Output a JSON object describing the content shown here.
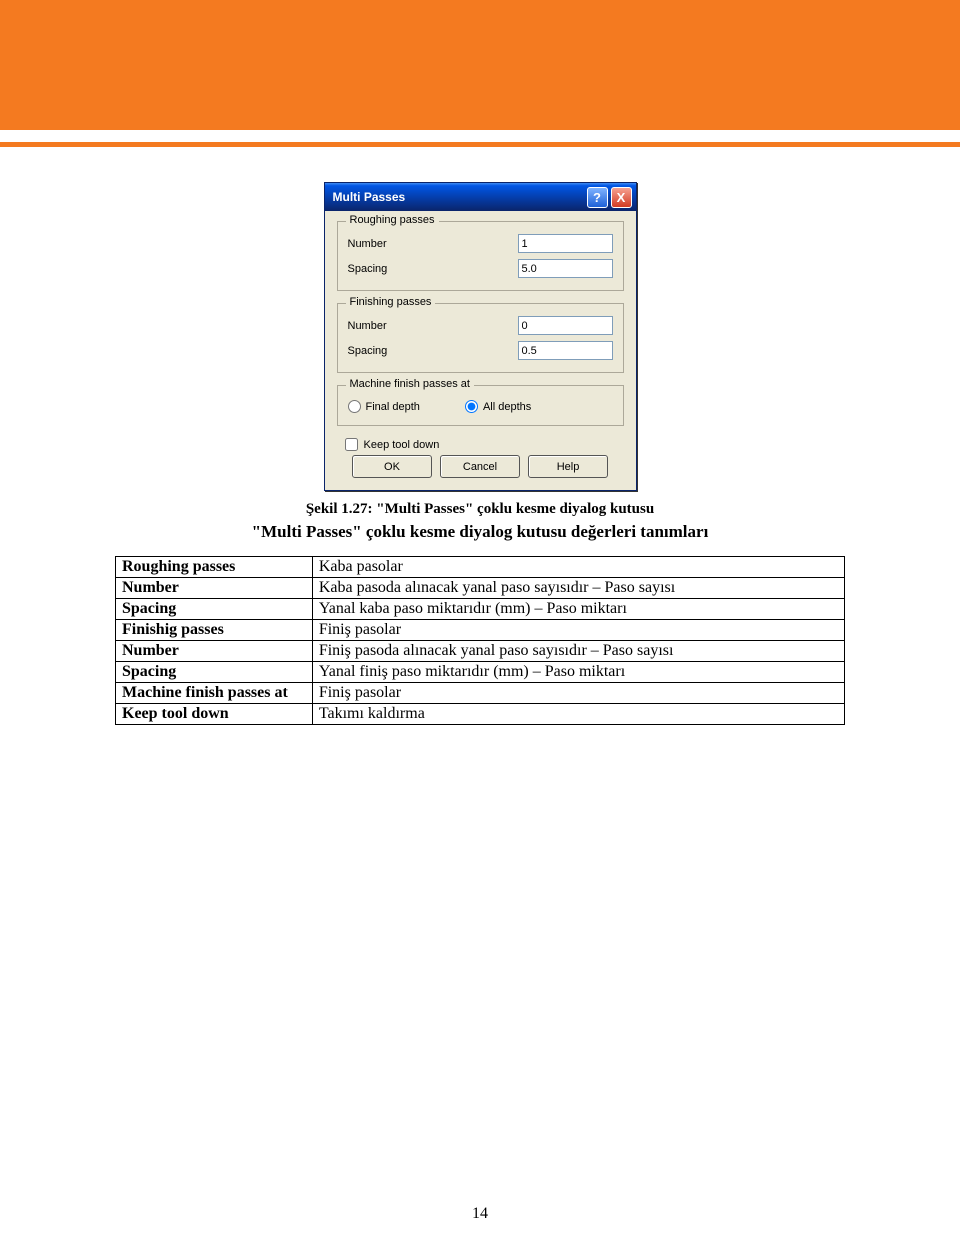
{
  "dialog": {
    "title": "Multi Passes",
    "help_glyph": "?",
    "close_glyph": "X",
    "roughing": {
      "legend": "Roughing passes",
      "number_label": "Number",
      "number_value": "1",
      "spacing_label": "Spacing",
      "spacing_value": "5.0"
    },
    "finishing": {
      "legend": "Finishing passes",
      "number_label": "Number",
      "number_value": "0",
      "spacing_label": "Spacing",
      "spacing_value": "0.5"
    },
    "machine_at": {
      "legend": "Machine finish passes at",
      "final_depth": "Final depth",
      "all_depths": "All depths"
    },
    "keep_tool_down": "Keep tool down",
    "buttons": {
      "ok": "OK",
      "cancel": "Cancel",
      "help": "Help"
    }
  },
  "caption": "Şekil 1.27: \"Multi Passes\" çoklu kesme diyalog kutusu",
  "subtitle": "\"Multi Passes\" çoklu kesme diyalog kutusu değerleri tanımları",
  "table": [
    {
      "term": "Roughing passes",
      "def": "Kaba pasolar"
    },
    {
      "term": "Number",
      "def": "Kaba pasoda alınacak yanal paso sayısıdır – Paso sayısı"
    },
    {
      "term": "Spacing",
      "def": "Yanal kaba paso miktarıdır (mm) – Paso miktarı"
    },
    {
      "term": "Finishig passes",
      "def": "Finiş pasolar"
    },
    {
      "term": "Number",
      "def": "Finiş pasoda alınacak yanal paso sayısıdır – Paso sayısı"
    },
    {
      "term": "Spacing",
      "def": "Yanal finiş paso miktarıdır (mm) – Paso miktarı"
    },
    {
      "term": "Machine finish passes at",
      "def": "Finiş pasolar"
    },
    {
      "term": "Keep tool down",
      "def": "Takımı kaldırma"
    }
  ],
  "page_number": "14"
}
